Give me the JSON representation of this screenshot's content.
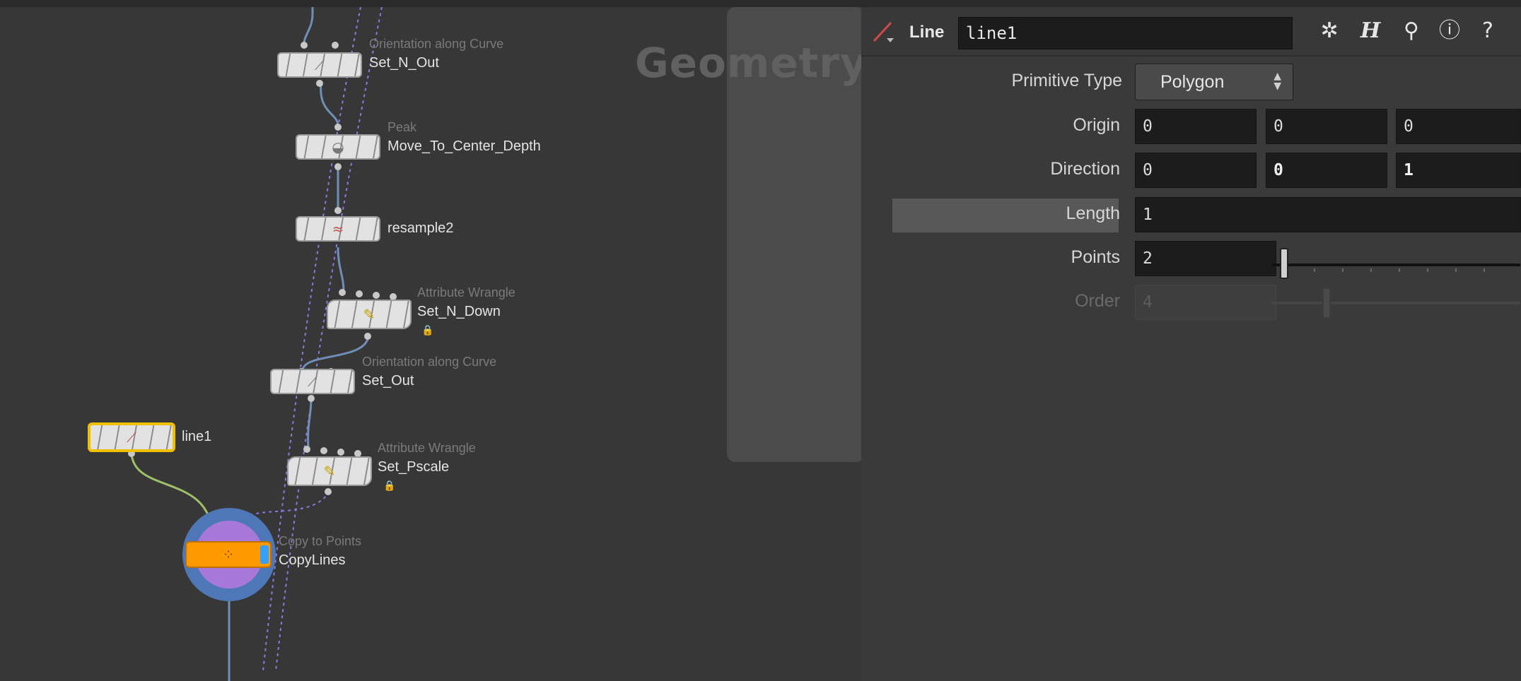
{
  "network": {
    "backdrop_title": "Geometry",
    "nodes": {
      "set_n_out": {
        "type": "Orientation along Curve",
        "name": "Set_N_Out"
      },
      "move_center": {
        "type": "Peak",
        "name": "Move_To_Center_Depth"
      },
      "resample2": {
        "type": "",
        "name": "resample2"
      },
      "set_n_down": {
        "type": "Attribute Wrangle",
        "name": "Set_N_Down"
      },
      "set_out": {
        "type": "Orientation along Curve",
        "name": "Set_Out"
      },
      "set_pscale": {
        "type": "Attribute Wrangle",
        "name": "Set_Pscale"
      },
      "line1": {
        "type": "",
        "name": "line1"
      },
      "copylines": {
        "type": "Copy to Points",
        "name": "CopyLines"
      }
    },
    "selected_node": "line1",
    "colors": {
      "selected_outline": "#f0c000",
      "copy_node": "#ff9900",
      "wire": "#6f8fb8",
      "ref_wire": "#8a7adf"
    }
  },
  "params": {
    "header": {
      "node_type": "Line",
      "node_name": "line1",
      "toolbar": [
        "gear-icon",
        "houdini-help-icon",
        "search-icon",
        "info-icon",
        "help-icon"
      ]
    },
    "primitive_type": {
      "label": "Primitive Type",
      "value": "Polygon"
    },
    "origin": {
      "label": "Origin",
      "x": "0",
      "y": "0",
      "z": "0"
    },
    "direction": {
      "label": "Direction",
      "x": "0",
      "y": "0",
      "z": "1"
    },
    "length": {
      "label": "Length",
      "value": "1"
    },
    "points": {
      "label": "Points",
      "value": "2"
    },
    "order": {
      "label": "Order",
      "value": "4"
    }
  }
}
